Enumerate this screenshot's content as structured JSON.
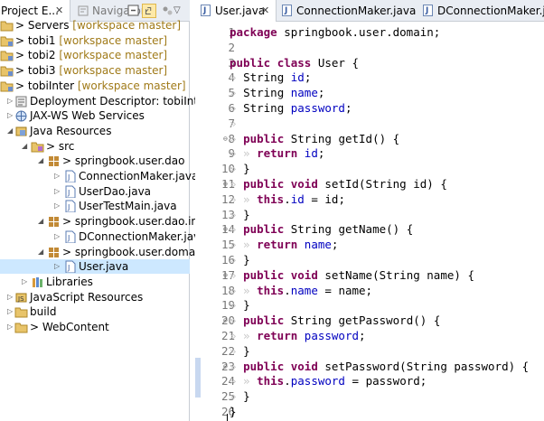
{
  "left_pane": {
    "tabs": {
      "project_explorer": "Project E...",
      "navigator": "Navigator"
    },
    "tree": [
      {
        "label": "Servers",
        "suffix": "[workspace master]",
        "icon": "folder-icon",
        "level": 0,
        "arrow": "collapsed",
        "prefix": ">"
      },
      {
        "label": "tobi1",
        "suffix": "[workspace master]",
        "icon": "project-icon",
        "level": 0,
        "arrow": "collapsed",
        "prefix": ">"
      },
      {
        "label": "tobi2",
        "suffix": "[workspace master]",
        "icon": "project-icon",
        "level": 0,
        "arrow": "collapsed",
        "prefix": ">"
      },
      {
        "label": "tobi3",
        "suffix": "[workspace master]",
        "icon": "project-icon",
        "level": 0,
        "arrow": "collapsed",
        "prefix": ">"
      },
      {
        "label": "tobiInter",
        "suffix": "[workspace master]",
        "icon": "project-icon",
        "level": 0,
        "arrow": "expanded",
        "prefix": ">"
      },
      {
        "label": "Deployment Descriptor: tobiInter",
        "suffix": "",
        "icon": "deployment-icon",
        "level": 1,
        "arrow": "collapsed",
        "prefix": ""
      },
      {
        "label": "JAX-WS Web Services",
        "suffix": "",
        "icon": "webservice-icon",
        "level": 1,
        "arrow": "collapsed",
        "prefix": ""
      },
      {
        "label": "Java Resources",
        "suffix": "",
        "icon": "java-resources-icon",
        "level": 1,
        "arrow": "expanded",
        "prefix": ""
      },
      {
        "label": "src",
        "suffix": "",
        "icon": "source-folder-icon",
        "level": 2,
        "arrow": "expanded",
        "prefix": ">"
      },
      {
        "label": "springbook.user.dao",
        "suffix": "",
        "icon": "package-icon",
        "level": 3,
        "arrow": "expanded",
        "prefix": ">"
      },
      {
        "label": "ConnectionMaker.java",
        "suffix": "",
        "icon": "java-file-icon",
        "level": 4,
        "arrow": "collapsed",
        "prefix": ""
      },
      {
        "label": "UserDao.java",
        "suffix": "",
        "icon": "java-file-icon",
        "level": 4,
        "arrow": "collapsed",
        "prefix": ""
      },
      {
        "label": "UserTestMain.java",
        "suffix": "",
        "icon": "java-file-icon",
        "level": 4,
        "arrow": "collapsed",
        "prefix": ""
      },
      {
        "label": "springbook.user.dao.imle",
        "suffix": "",
        "icon": "package-icon",
        "level": 3,
        "arrow": "expanded",
        "prefix": ">"
      },
      {
        "label": "DConnectionMaker.java",
        "suffix": "",
        "icon": "java-file-icon",
        "level": 4,
        "arrow": "collapsed",
        "prefix": ""
      },
      {
        "label": "springbook.user.domain",
        "suffix": "",
        "icon": "package-icon",
        "level": 3,
        "arrow": "expanded",
        "prefix": ">"
      },
      {
        "label": "User.java",
        "suffix": "",
        "icon": "java-file-icon",
        "level": 4,
        "arrow": "collapsed",
        "prefix": "",
        "selected": true
      },
      {
        "label": "Libraries",
        "suffix": "",
        "icon": "library-icon",
        "level": 2,
        "arrow": "collapsed",
        "prefix": ""
      },
      {
        "label": "JavaScript Resources",
        "suffix": "",
        "icon": "javascript-icon",
        "level": 1,
        "arrow": "collapsed",
        "prefix": ""
      },
      {
        "label": "build",
        "suffix": "",
        "icon": "folder-icon",
        "level": 1,
        "arrow": "collapsed",
        "prefix": ""
      },
      {
        "label": "WebContent",
        "suffix": "",
        "icon": "folder-icon",
        "level": 1,
        "arrow": "collapsed",
        "prefix": ">"
      }
    ]
  },
  "editor": {
    "tabs": [
      "User.java",
      "ConnectionMaker.java",
      "DConnectionMaker.java"
    ],
    "active_tab": "User.java",
    "lines": [
      {
        "n": "1",
        "fold": false,
        "parts": [
          [
            "kw",
            "package"
          ],
          [
            "ws",
            " "
          ],
          [
            "p",
            "springbook.user.domain;"
          ]
        ]
      },
      {
        "n": "2",
        "fold": false,
        "parts": []
      },
      {
        "n": "3",
        "fold": false,
        "parts": [
          [
            "kw",
            "public"
          ],
          [
            "ws",
            " "
          ],
          [
            "kw",
            "class"
          ],
          [
            "ws",
            " "
          ],
          [
            "p",
            "User"
          ],
          [
            "ws",
            " "
          ],
          [
            "p",
            "{"
          ]
        ]
      },
      {
        "n": "4",
        "fold": false,
        "parts": [
          [
            "ws",
            "» "
          ],
          [
            "p",
            "String"
          ],
          [
            "ws",
            " "
          ],
          [
            "fld",
            "id"
          ],
          [
            "p",
            ";"
          ]
        ]
      },
      {
        "n": "5",
        "fold": false,
        "parts": [
          [
            "ws",
            "» "
          ],
          [
            "p",
            "String"
          ],
          [
            "ws",
            " "
          ],
          [
            "fld",
            "name"
          ],
          [
            "p",
            ";"
          ]
        ]
      },
      {
        "n": "6",
        "fold": false,
        "parts": [
          [
            "ws",
            "» "
          ],
          [
            "p",
            "String"
          ],
          [
            "ws",
            " "
          ],
          [
            "fld",
            "password"
          ],
          [
            "p",
            ";"
          ]
        ]
      },
      {
        "n": "7",
        "fold": false,
        "parts": [
          [
            "ws",
            "» "
          ]
        ]
      },
      {
        "n": "8",
        "fold": true,
        "parts": [
          [
            "ws",
            "» "
          ],
          [
            "kw",
            "public"
          ],
          [
            "ws",
            " "
          ],
          [
            "p",
            "String"
          ],
          [
            "ws",
            " "
          ],
          [
            "p",
            "getId()"
          ],
          [
            "ws",
            " "
          ],
          [
            "p",
            "{"
          ]
        ]
      },
      {
        "n": "9",
        "fold": false,
        "parts": [
          [
            "ws",
            "» » "
          ],
          [
            "kw",
            "return"
          ],
          [
            "ws",
            " "
          ],
          [
            "fld",
            "id"
          ],
          [
            "p",
            ";"
          ]
        ]
      },
      {
        "n": "10",
        "fold": false,
        "parts": [
          [
            "ws",
            "» "
          ],
          [
            "p",
            "}"
          ]
        ]
      },
      {
        "n": "11",
        "fold": true,
        "parts": [
          [
            "ws",
            "» "
          ],
          [
            "kw",
            "public"
          ],
          [
            "ws",
            " "
          ],
          [
            "kw",
            "void"
          ],
          [
            "ws",
            " "
          ],
          [
            "p",
            "setId(String"
          ],
          [
            "ws",
            " "
          ],
          [
            "p",
            "id)"
          ],
          [
            "ws",
            " "
          ],
          [
            "p",
            "{"
          ]
        ]
      },
      {
        "n": "12",
        "fold": false,
        "parts": [
          [
            "ws",
            "» » "
          ],
          [
            "kw",
            "this"
          ],
          [
            "p",
            "."
          ],
          [
            "fld",
            "id"
          ],
          [
            "ws",
            " "
          ],
          [
            "p",
            "="
          ],
          [
            "ws",
            " "
          ],
          [
            "p",
            "id;"
          ]
        ]
      },
      {
        "n": "13",
        "fold": false,
        "parts": [
          [
            "ws",
            "» "
          ],
          [
            "p",
            "}"
          ]
        ]
      },
      {
        "n": "14",
        "fold": true,
        "parts": [
          [
            "ws",
            "» "
          ],
          [
            "kw",
            "public"
          ],
          [
            "ws",
            " "
          ],
          [
            "p",
            "String"
          ],
          [
            "ws",
            " "
          ],
          [
            "p",
            "getName()"
          ],
          [
            "ws",
            " "
          ],
          [
            "p",
            "{"
          ]
        ]
      },
      {
        "n": "15",
        "fold": false,
        "parts": [
          [
            "ws",
            "» » "
          ],
          [
            "kw",
            "return"
          ],
          [
            "ws",
            " "
          ],
          [
            "fld",
            "name"
          ],
          [
            "p",
            ";"
          ]
        ]
      },
      {
        "n": "16",
        "fold": false,
        "parts": [
          [
            "ws",
            "» "
          ],
          [
            "p",
            "}"
          ]
        ]
      },
      {
        "n": "17",
        "fold": true,
        "parts": [
          [
            "ws",
            "» "
          ],
          [
            "kw",
            "public"
          ],
          [
            "ws",
            " "
          ],
          [
            "kw",
            "void"
          ],
          [
            "ws",
            " "
          ],
          [
            "p",
            "setName(String"
          ],
          [
            "ws",
            " "
          ],
          [
            "p",
            "name)"
          ],
          [
            "ws",
            " "
          ],
          [
            "p",
            "{"
          ]
        ]
      },
      {
        "n": "18",
        "fold": false,
        "parts": [
          [
            "ws",
            "» » "
          ],
          [
            "kw",
            "this"
          ],
          [
            "p",
            "."
          ],
          [
            "fld",
            "name"
          ],
          [
            "ws",
            " "
          ],
          [
            "p",
            "="
          ],
          [
            "ws",
            " "
          ],
          [
            "p",
            "name;"
          ]
        ]
      },
      {
        "n": "19",
        "fold": false,
        "parts": [
          [
            "ws",
            "» "
          ],
          [
            "p",
            "}"
          ]
        ]
      },
      {
        "n": "20",
        "fold": true,
        "parts": [
          [
            "ws",
            "» "
          ],
          [
            "kw",
            "public"
          ],
          [
            "ws",
            " "
          ],
          [
            "p",
            "String"
          ],
          [
            "ws",
            " "
          ],
          [
            "p",
            "getPassword()"
          ],
          [
            "ws",
            " "
          ],
          [
            "p",
            "{"
          ]
        ]
      },
      {
        "n": "21",
        "fold": false,
        "parts": [
          [
            "ws",
            "» » "
          ],
          [
            "kw",
            "return"
          ],
          [
            "ws",
            " "
          ],
          [
            "fld",
            "password"
          ],
          [
            "p",
            ";"
          ]
        ]
      },
      {
        "n": "22",
        "fold": false,
        "parts": [
          [
            "ws",
            "» "
          ],
          [
            "p",
            "}"
          ]
        ]
      },
      {
        "n": "23",
        "fold": true,
        "parts": [
          [
            "ws",
            "» "
          ],
          [
            "kw",
            "public"
          ],
          [
            "ws",
            " "
          ],
          [
            "kw",
            "void"
          ],
          [
            "ws",
            " "
          ],
          [
            "p",
            "setPassword(String"
          ],
          [
            "ws",
            " "
          ],
          [
            "p",
            "password)"
          ],
          [
            "ws",
            " "
          ],
          [
            "p",
            "{"
          ]
        ]
      },
      {
        "n": "24",
        "fold": false,
        "parts": [
          [
            "ws",
            "» » "
          ],
          [
            "kw",
            "this"
          ],
          [
            "p",
            "."
          ],
          [
            "fld",
            "password"
          ],
          [
            "ws",
            " "
          ],
          [
            "p",
            "="
          ],
          [
            "ws",
            " "
          ],
          [
            "p",
            "password;"
          ]
        ]
      },
      {
        "n": "25",
        "fold": false,
        "parts": [
          [
            "ws",
            "» "
          ],
          [
            "p",
            "}"
          ]
        ]
      },
      {
        "n": "26",
        "fold": false,
        "parts": [
          [
            "p",
            "}"
          ]
        ]
      }
    ]
  },
  "colors": {
    "keyword": "#7f0055",
    "field": "#0000c0",
    "workspace_decoration": "#a07a18",
    "selection": "#cde8ff"
  }
}
